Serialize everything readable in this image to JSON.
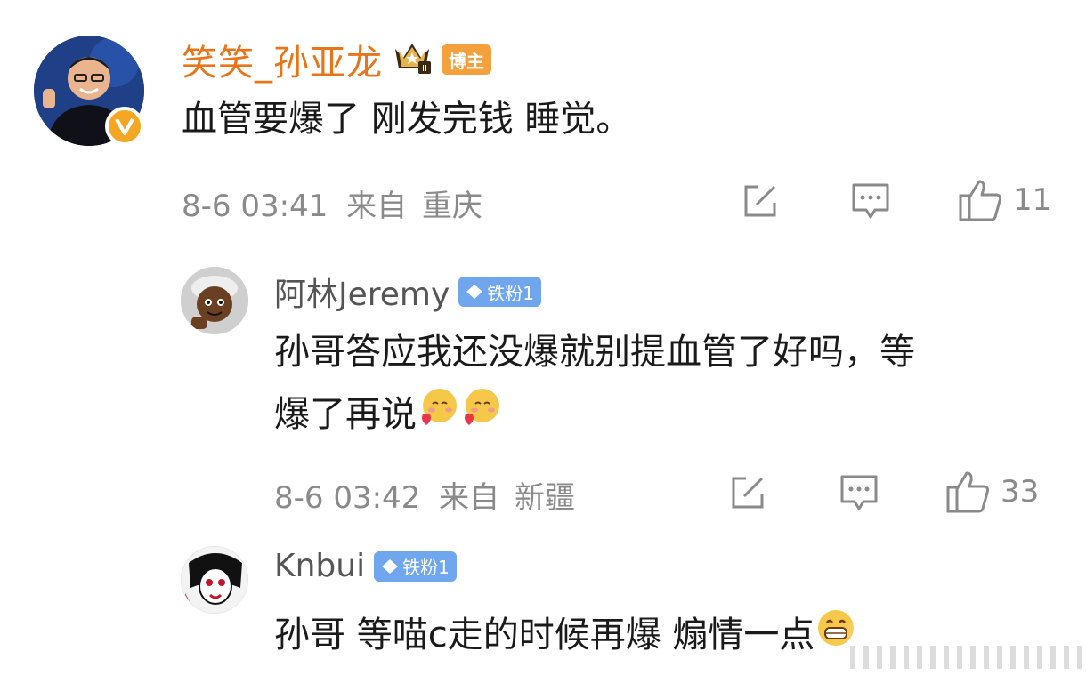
{
  "comments": [
    {
      "author": "笑笑_孙亚龙",
      "badge": "博主",
      "crown_icon": "crown-level-ii-icon",
      "verified_icon": "verified-v-icon",
      "text": "血管要爆了 刚发完钱 睡觉。",
      "time": "8-6 03:41",
      "from": "来自",
      "location": "重庆",
      "likes": "11"
    },
    {
      "author": "阿林Jeremy",
      "badge": "铁粉1",
      "text_line1": "孙哥答应我还没爆就别提血管了好吗，等",
      "text_line2": "爆了再说",
      "emoji": "shy-heart-emoji",
      "time": "8-6 03:42",
      "from": "来自",
      "location": "新疆",
      "likes": "33"
    },
    {
      "author": "Knbui",
      "badge": "铁粉1",
      "text": "孙哥 等喵c走的时候再爆 煽情一点",
      "emoji": "grin-emoji"
    }
  ],
  "colors": {
    "author_main": "#e8751a",
    "blogger_badge": "#f4a03c",
    "fan_badge": "#6fa6ee",
    "meta_gray": "#8a8a8a",
    "verified": "#f5a623"
  }
}
